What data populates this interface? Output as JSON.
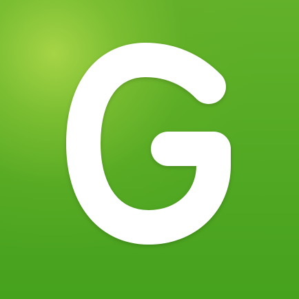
{
  "app_icon": {
    "icon": "g-logo-icon",
    "colors": {
      "background_top": "#63b12a",
      "background_bottom": "#46a11d",
      "glow": "#aad648",
      "glyph": "#ffffff"
    }
  }
}
